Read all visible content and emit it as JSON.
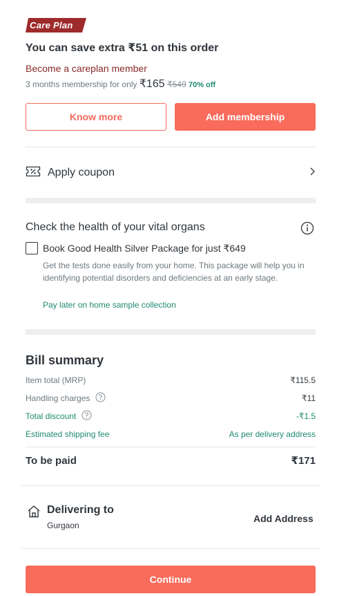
{
  "care_plan": {
    "badge": "Care Plan",
    "title": "You can save extra ₹51 on this order",
    "become_member": "Become a careplan member",
    "membership_prefix": "3 months membership for only",
    "price": "₹165",
    "mrp": "₹549",
    "discount": "70% off",
    "know_more_label": "Know more",
    "add_membership_label": "Add membership"
  },
  "coupon": {
    "label": "Apply coupon"
  },
  "vital_organs": {
    "title": "Check the health of your vital organs",
    "package_label": "Book Good Health Silver Package for just ₹649",
    "package_description": "Get the tests done easily from your home. This package will help you in identifying potential disorders and deficiencies at an early stage.",
    "pay_later": "Pay later on home sample collection"
  },
  "bill": {
    "title": "Bill summary",
    "rows": [
      {
        "label": "Item total (MRP)",
        "value": "₹115.5"
      },
      {
        "label": "Handling charges",
        "value": "₹11"
      },
      {
        "label": "Total discount",
        "value": "-₹1.5"
      },
      {
        "label": "Estimated shipping fee",
        "value": "As per delivery address"
      }
    ],
    "to_be_paid_label": "To be paid",
    "to_be_paid_value": "₹171"
  },
  "delivery": {
    "title": "Delivering to",
    "city": "Gurgaon",
    "add_address": "Add Address"
  },
  "footer": {
    "continue_label": "Continue"
  },
  "colors": {
    "accent": "#f96b5b",
    "green": "#1f8a70",
    "care_badge": "#9e2a2b"
  }
}
